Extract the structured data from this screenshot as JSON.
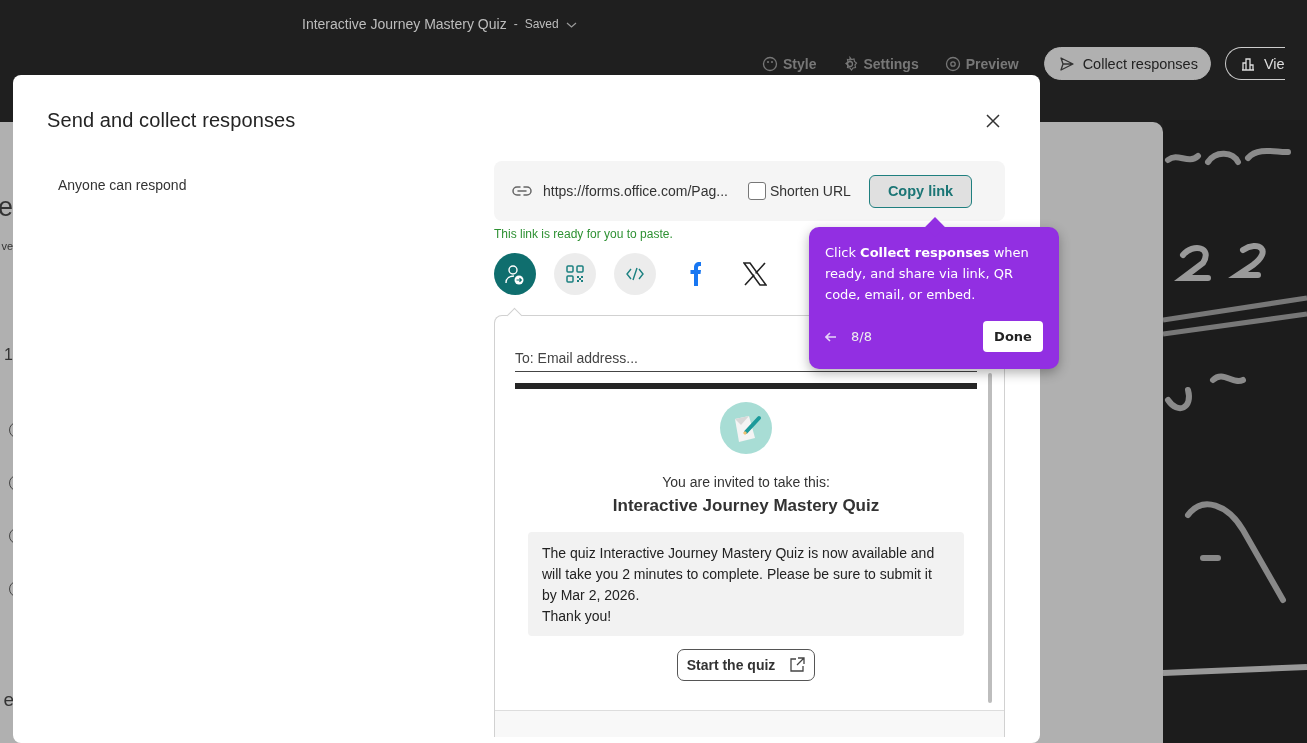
{
  "header": {
    "title": "Interactive Journey Mastery Quiz",
    "separator": "-",
    "save_status": "Saved"
  },
  "toolbar": [
    {
      "label": "Style",
      "kind": "text",
      "selected": false
    },
    {
      "label": "Settings",
      "kind": "text",
      "selected": false
    },
    {
      "label": "Preview",
      "kind": "text",
      "selected": false
    },
    {
      "label": "Collect responses",
      "kind": "button",
      "selected": true
    },
    {
      "label": "Vie",
      "kind": "button",
      "selected": false
    }
  ],
  "background_form": {
    "fragments": [
      "e",
      "ve",
      "1",
      "e"
    ],
    "radios": [
      {
        "selected": false
      },
      {
        "selected": false
      },
      {
        "selected": false
      },
      {
        "selected": false
      }
    ]
  },
  "dialog": {
    "title": "Send and collect responses",
    "audience": "Anyone can respond",
    "link": {
      "url": "https://forms.office.com/Pag...",
      "shorten_url": {
        "label": "Shorten URL",
        "checked": false
      },
      "copy_button": "Copy link",
      "status": "This link is ready for you to paste."
    },
    "share_options": [
      {
        "kind": "email",
        "selected": true
      },
      {
        "kind": "qr",
        "selected": false
      },
      {
        "kind": "embed",
        "selected": false
      },
      {
        "kind": "facebook",
        "selected": false
      },
      {
        "kind": "x",
        "selected": false
      }
    ],
    "email": {
      "placeholder": "To: Email address...",
      "invite": "You are invited to take this:",
      "form_title": "Interactive Journey Mastery Quiz",
      "message": [
        "The quiz Interactive Journey Mastery Quiz is now available and will take you 2 minutes to complete. Please be sure to submit it by Mar 2, 2026.",
        "Thank you!"
      ],
      "start_button": "Start the quiz"
    }
  },
  "tour_tip": {
    "text": "Click **Collect responses** when ready, and share via link, QR code, email, or embed.",
    "step": "8/8",
    "done": "Done"
  }
}
